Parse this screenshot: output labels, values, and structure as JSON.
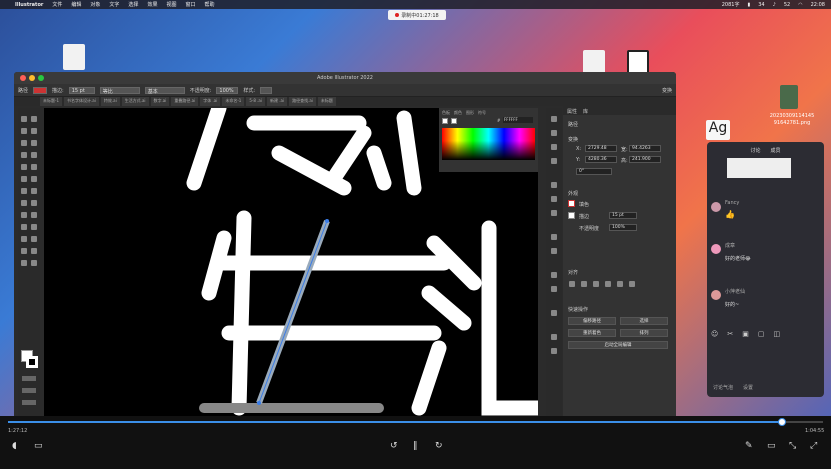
{
  "menubar": {
    "apple": "",
    "app": "Illustrator",
    "items": [
      "文件",
      "编辑",
      "对象",
      "文字",
      "选择",
      "效果",
      "视图",
      "窗口",
      "帮助"
    ],
    "status_count": "2081字",
    "battery": "34",
    "volume": "52",
    "time": "22:08"
  },
  "recording": {
    "label": "录制中01:27:18"
  },
  "desktop": {
    "file_label": "20230309114145\n91642781.png"
  },
  "window": {
    "title": "Adobe Illustrator 2022",
    "control_bar": {
      "label": "路径",
      "stroke_label": "描边:",
      "stroke_value": "15 pt",
      "profile": "等比",
      "brush": "基本",
      "opacity_label": "不透明度:",
      "opacity_value": "100%",
      "style_label": "样式:",
      "transform": "变换"
    },
    "tabs": [
      "未标题-1",
      "书名字体设计.ai",
      "特效.ai",
      "生活方式.ai",
      "数字.ai",
      "重叠路径.ai",
      "字体 .ai",
      "未命名-1",
      "5-8 .ai",
      "新建 .ai",
      "路径查找.ai",
      "未标题"
    ],
    "color_panel": {
      "tabs": [
        "色板",
        "颜色",
        "图形",
        "符号"
      ],
      "hex_label": "#",
      "hex": "FFFFFF"
    },
    "properties": {
      "tabs": [
        "属性",
        "库"
      ],
      "path_label": "路径",
      "transform_label": "变换",
      "x_label": "X:",
      "x": "2729.48",
      "y_label": "Y:",
      "y": "4280.36",
      "w_label": "宽:",
      "w": "94.4263",
      "h_label": "高:",
      "h": "241.900",
      "angle": "0°",
      "appearance_label": "外观",
      "fill_label": "填色",
      "stroke_label": "描边",
      "stroke_value": "15 pt",
      "opacity_label": "不透明度",
      "opacity_value": "100%",
      "align_label": "对齐",
      "quick_actions_label": "快速操作",
      "btn_edit_path": "偏移路径",
      "btn_select": "选择",
      "btn_recolor": "重新着色",
      "btn_arrange": "排列",
      "btn_global_edit": "启动全局编辑"
    },
    "canvas": {
      "glyph_top": "度",
      "glyph_main": "生"
    }
  },
  "chat": {
    "tabs": [
      "讨论",
      "成员"
    ],
    "messages": [
      {
        "user": "Fancy",
        "text": "👍"
      },
      {
        "user": "成章",
        "text": "好的老师😂"
      },
      {
        "user": "小萍老仙",
        "text": "好的~"
      }
    ],
    "footer_left": "讨论气泡",
    "footer_right": "设置"
  },
  "player": {
    "current": "1:27:12",
    "total": "1:04:55",
    "progress": 0.95
  }
}
